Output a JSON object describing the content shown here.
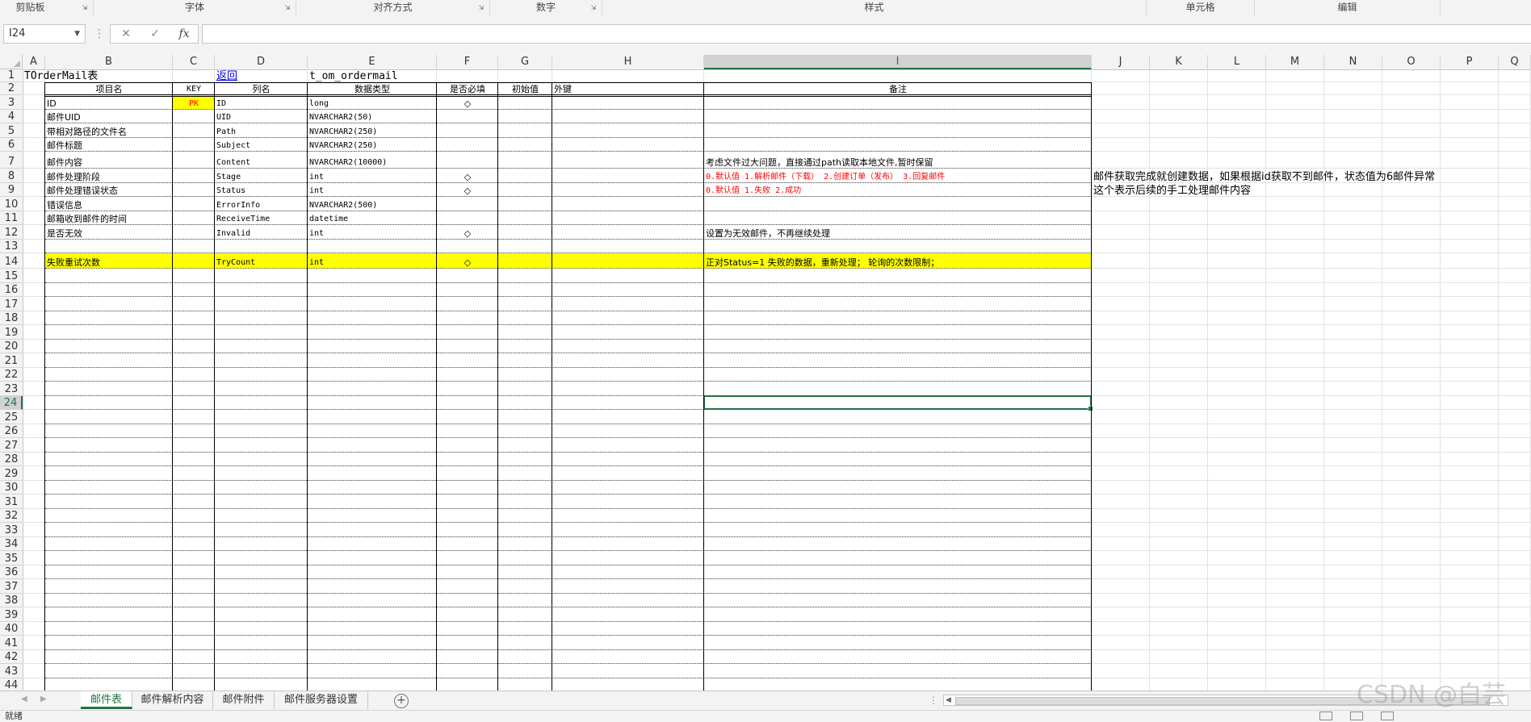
{
  "ribbon": {
    "groups": [
      "剪贴板",
      "字体",
      "对齐方式",
      "数字",
      "样式",
      "单元格",
      "编辑"
    ]
  },
  "formula_bar": {
    "name_box": "I24",
    "cancel_icon": "✕",
    "enter_icon": "✓",
    "fx_label": "fx",
    "formula": ""
  },
  "grid": {
    "columns": [
      "A",
      "B",
      "C",
      "D",
      "E",
      "F",
      "G",
      "H",
      "I",
      "J",
      "K",
      "L",
      "M",
      "N",
      "O",
      "P",
      "Q"
    ],
    "selected_column": "I",
    "rows": [
      "1",
      "2",
      "3",
      "4",
      "5",
      "6",
      "7",
      "8",
      "9",
      "10",
      "11",
      "12",
      "13",
      "14",
      "15",
      "16",
      "17",
      "18",
      "19",
      "20",
      "21",
      "22",
      "23",
      "24",
      "25",
      "26",
      "27",
      "28",
      "29",
      "30",
      "31",
      "32",
      "33",
      "34",
      "35",
      "36",
      "37",
      "38",
      "39",
      "40",
      "41",
      "42",
      "43",
      "44"
    ],
    "selected_row": "24"
  },
  "sheet": {
    "title": "TOrderMail表",
    "back_link": "返回",
    "table_name": "t_om_ordermail",
    "headers": {
      "item": "项目名",
      "key": "KEY",
      "column": "列名",
      "datatype": "数据类型",
      "required": "是否必填",
      "default": "初始值",
      "foreign": "外键",
      "remark": "备注"
    },
    "rows": [
      {
        "item": "ID",
        "key": "PK",
        "column": "ID",
        "datatype": "long",
        "required": "◇",
        "remark": ""
      },
      {
        "item": "邮件UID",
        "key": "",
        "column": "UID",
        "datatype": "NVARCHAR2(50)",
        "required": "",
        "remark": ""
      },
      {
        "item": "带相对路径的文件名",
        "key": "",
        "column": "Path",
        "datatype": "NVARCHAR2(250)",
        "required": "",
        "remark": ""
      },
      {
        "item": "邮件标题",
        "key": "",
        "column": "Subject",
        "datatype": "NVARCHAR2(250)",
        "required": "",
        "remark": ""
      },
      {
        "item": "邮件内容",
        "key": "",
        "column": "Content",
        "datatype": "NVARCHAR2(10000)",
        "required": "",
        "remark": "考虑文件过大问题，直接通过path读取本地文件,暂时保留"
      },
      {
        "item": "邮件处理阶段",
        "key": "",
        "column": "Stage",
        "datatype": "int",
        "required": "◇",
        "remark": "0.默认值 1.解析邮件（下载） 2.创建订单（发布） 3.回复邮件"
      },
      {
        "item": "邮件处理错误状态",
        "key": "",
        "column": "Status",
        "datatype": "int",
        "required": "◇",
        "remark": "0.默认值 1.失败 2.成功"
      },
      {
        "item": "错误信息",
        "key": "",
        "column": "ErrorInfo",
        "datatype": "NVARCHAR2(500)",
        "required": "",
        "remark": ""
      },
      {
        "item": "邮箱收到邮件的时间",
        "key": "",
        "column": "ReceiveTime",
        "datatype": "datetime",
        "required": "",
        "remark": ""
      },
      {
        "item": "是否无效",
        "key": "",
        "column": "Invalid",
        "datatype": "int",
        "required": "◇",
        "remark": "设置为无效邮件，不再继续处理"
      },
      {
        "item": "",
        "key": "",
        "column": "",
        "datatype": "",
        "required": "",
        "remark": ""
      },
      {
        "item": "失败重试次数",
        "key": "",
        "column": "TryCount",
        "datatype": "int",
        "required": "◇",
        "remark": "正对Status=1 失败的数据，重新处理； 轮询的次数限制；"
      }
    ],
    "side_note_1": "邮件获取完成就创建数据，如果根据id获取不到邮件，状态值为6邮件异常",
    "side_note_2": "这个表示后续的手工处理邮件内容"
  },
  "tabs": [
    "邮件表",
    "邮件解析内容",
    "邮件附件",
    "邮件服务器设置"
  ],
  "active_tab": "邮件表",
  "status_bar": {
    "text": "就绪"
  },
  "watermark": "CSDN @白芸",
  "colors": {
    "accent": "#217346",
    "highlight_yellow": "#ffff00",
    "remark_red": "#ff0000",
    "link_blue": "#0000ee"
  }
}
